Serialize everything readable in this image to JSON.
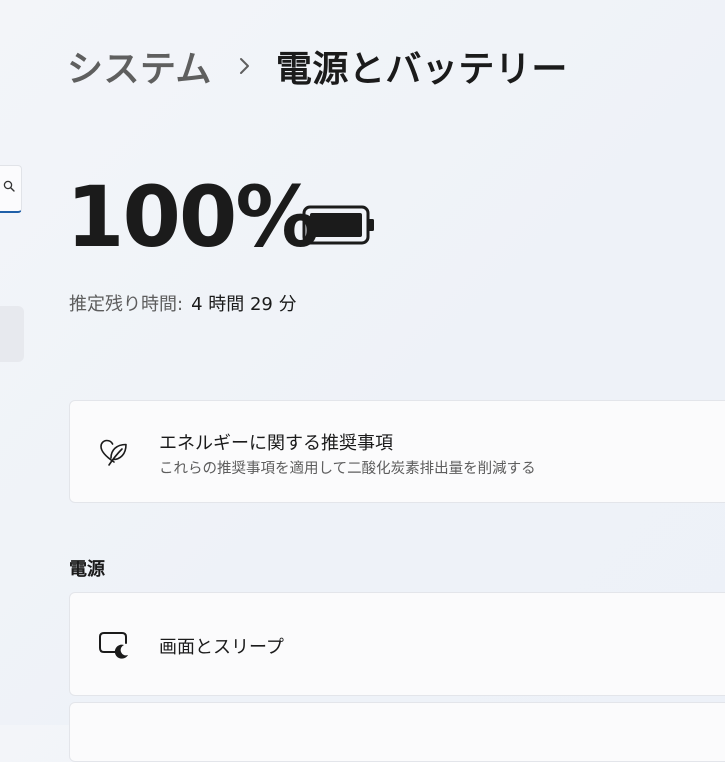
{
  "breadcrumb": {
    "parent": "システム",
    "current": "電源とバッテリー"
  },
  "battery": {
    "percent_text": "100%",
    "level": 1.0,
    "remaining_label": "推定残り時間:",
    "remaining_value": "4 時間 29 分"
  },
  "energy_card": {
    "icon": "leaf-heart-icon",
    "title": "エネルギーに関する推奨事項",
    "description": "これらの推奨事項を適用して二酸化炭素排出量を削減する"
  },
  "power_section": {
    "title": "電源",
    "items": [
      {
        "icon": "screen-sleep-icon",
        "label": "画面とスリープ"
      }
    ]
  },
  "colors": {
    "accent": "#1f5fa8",
    "text_primary": "#1b1b1b",
    "text_secondary": "#5d5d5d"
  }
}
